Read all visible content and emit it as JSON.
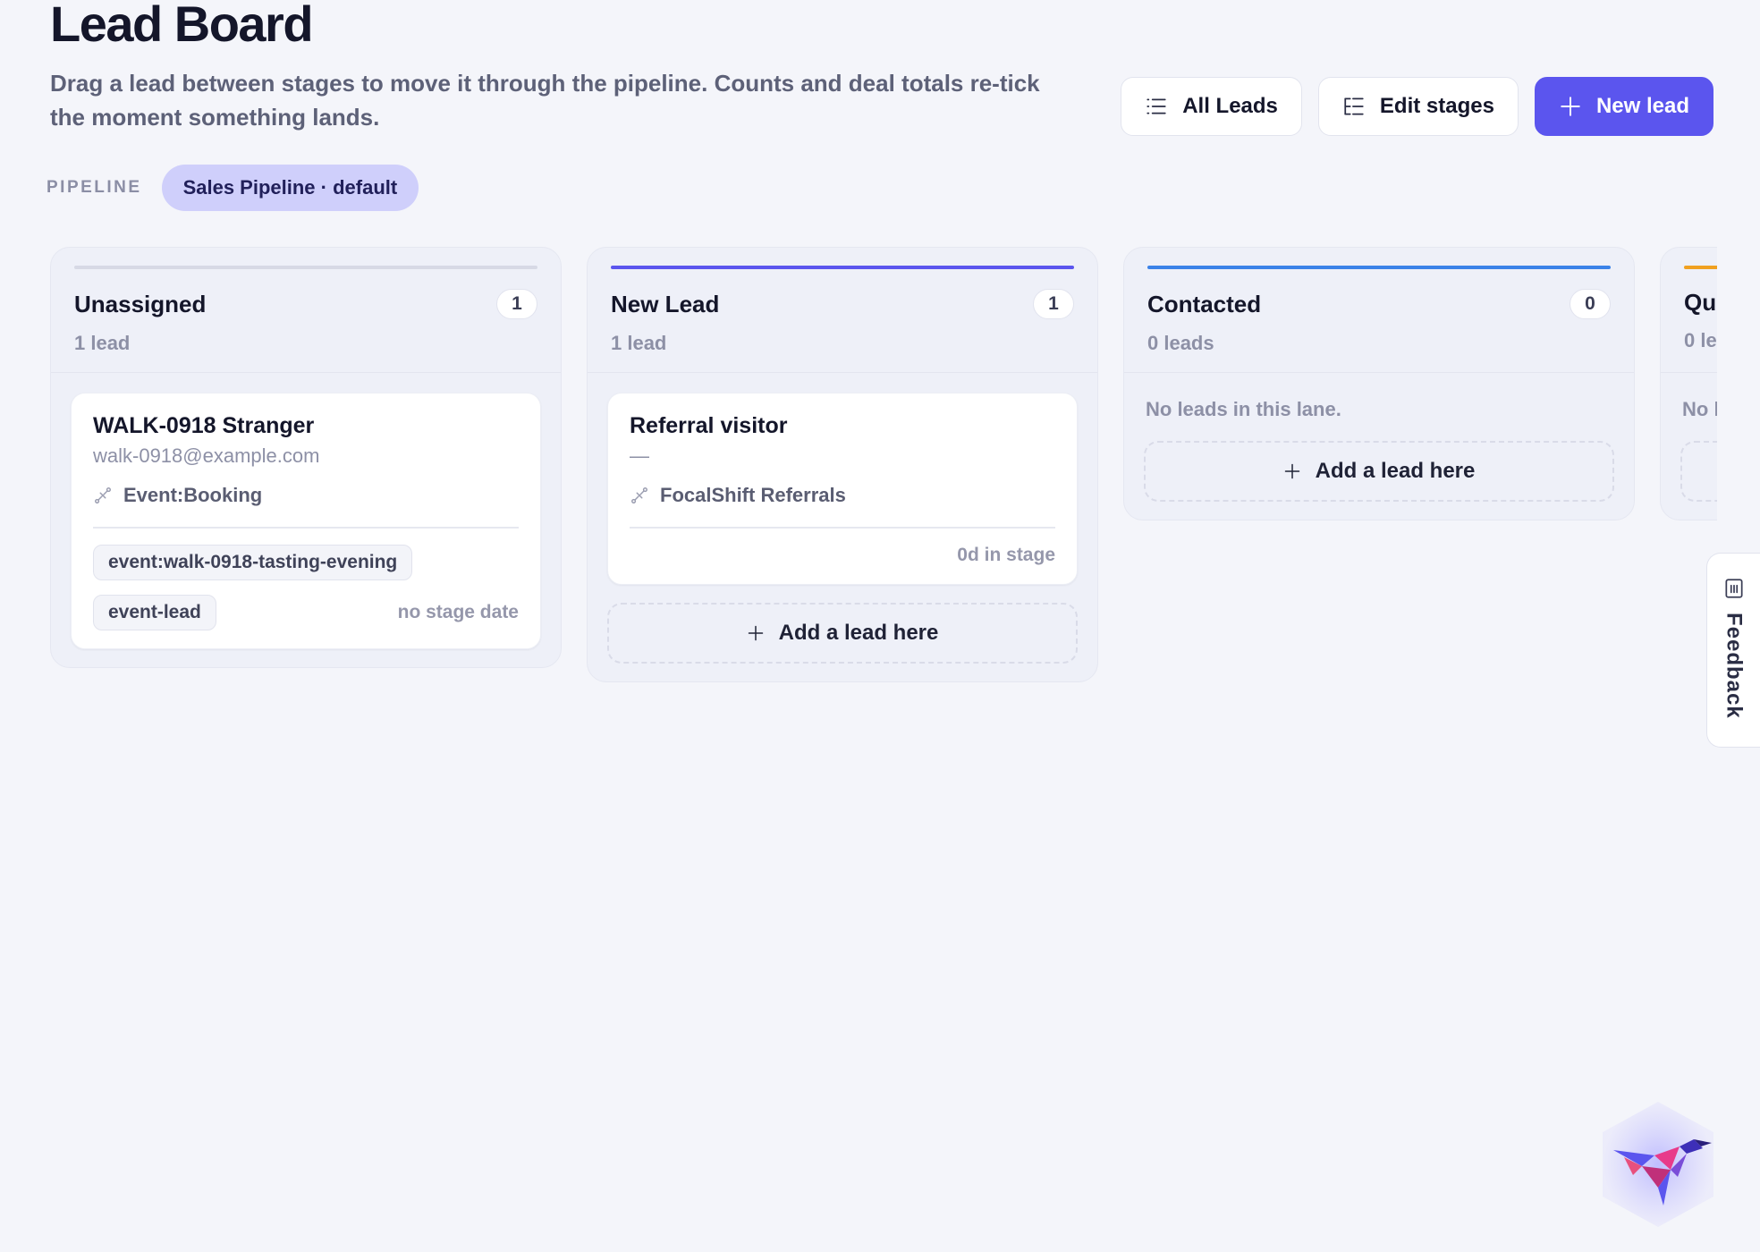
{
  "header": {
    "title": "Lead Board",
    "subtitle": "Drag a lead between stages to move it through the pipeline. Counts and deal totals re-tick the moment something lands."
  },
  "toolbar": {
    "all_leads_label": "All Leads",
    "edit_stages_label": "Edit stages",
    "new_lead_label": "New lead"
  },
  "pipeline": {
    "label": "PIPELINE",
    "selected": "Sales Pipeline · default"
  },
  "lanes": [
    {
      "title": "Unassigned",
      "count": "1",
      "subtitle": "1 lead",
      "bar_color": "#d7d9e5",
      "cards": [
        {
          "name": "WALK-0918 Stranger",
          "email": "walk-0918@example.com",
          "source": "Event:Booking",
          "tags": [
            "event:walk-0918-tasting-evening",
            "event-lead"
          ],
          "stage_time": "no stage date"
        }
      ]
    },
    {
      "title": "New Lead",
      "count": "1",
      "subtitle": "1 lead",
      "bar_color": "#5b55ee",
      "cards": [
        {
          "name": "Referral visitor",
          "email": "—",
          "source": "FocalShift Referrals",
          "tags": [],
          "stage_time": "0d in stage"
        }
      ],
      "add_label": "Add a lead here"
    },
    {
      "title": "Contacted",
      "count": "0",
      "subtitle": "0 leads",
      "bar_color": "#3b82e8",
      "empty_text": "No leads in this lane.",
      "add_label": "Add a lead here"
    },
    {
      "title": "Qu",
      "subtitle": "0 le",
      "bar_color": "#f0a020",
      "empty_text": "No l"
    }
  ],
  "feedback": {
    "label": "Feedback"
  },
  "icons": {
    "all_leads": "list-icon",
    "edit_stages": "stages-icon",
    "new_lead": "plus-icon",
    "source": "link-icon",
    "add": "plus-icon",
    "feedback": "feedback-icon",
    "logo": "hummingbird-logo-icon"
  }
}
